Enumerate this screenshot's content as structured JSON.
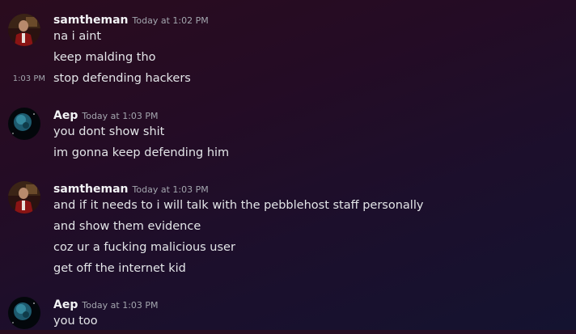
{
  "messages": [
    {
      "author": "samtheman",
      "time": "Today at 1:02 PM",
      "avatar_icon": "red-portrait-avatar",
      "lines": [
        {
          "text": "na i aint"
        },
        {
          "text": "keep malding tho"
        },
        {
          "text": "stop defending hackers",
          "hover_time": "1:03 PM"
        }
      ]
    },
    {
      "author": "Aep",
      "time": "Today at 1:03 PM",
      "avatar_icon": "planet-avatar",
      "lines": [
        {
          "text": "you dont show shit"
        },
        {
          "text": "im gonna keep defending him"
        }
      ]
    },
    {
      "author": "samtheman",
      "time": "Today at 1:03 PM",
      "avatar_icon": "red-portrait-avatar",
      "lines": [
        {
          "text": "and if it needs to i will talk with the pebblehost staff personally"
        },
        {
          "text": "and show them evidence"
        },
        {
          "text": "coz ur a fucking malicious user"
        },
        {
          "text": "get off the internet kid"
        }
      ]
    },
    {
      "author": "Aep",
      "time": "Today at 1:03 PM",
      "avatar_icon": "planet-avatar",
      "lines": [
        {
          "text": "you too"
        }
      ]
    }
  ]
}
